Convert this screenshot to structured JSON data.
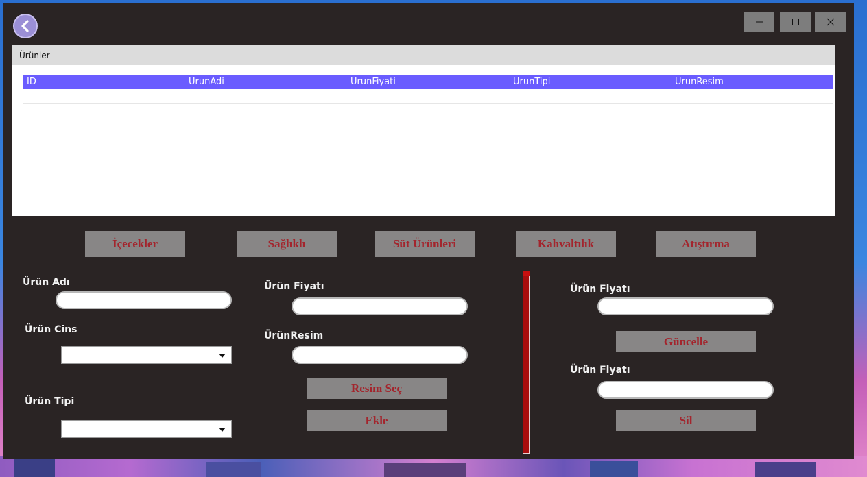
{
  "grid": {
    "caption": "Ürünler",
    "columns": [
      "ID",
      "UrunAdi",
      "UrunFiyati",
      "UrunTipi",
      "UrunResim"
    ]
  },
  "categories": [
    "İçecekler",
    "Sağlıklı",
    "Süt Ürünleri",
    "Kahvaltılık",
    "Atıştırma"
  ],
  "form": {
    "urun_adi_label": "Ürün Adı",
    "urun_cins_label": "Ürün Cins",
    "urun_tipi_label": "Ürün Tipi",
    "urun_fiyati_label": "Ürün Fiyatı",
    "urun_resim_label": "ÜrünResim",
    "resim_sec_label": "Resim Seç",
    "ekle_label": "Ekle",
    "urun_adi_value": "",
    "urun_fiyati_value": "",
    "urun_resim_value": "",
    "urun_cins_selected": "",
    "urun_tipi_selected": ""
  },
  "right_panel": {
    "update_price_label": "Ürün Fiyatı",
    "guncelle_label": "Güncelle",
    "delete_price_label": "Ürün Fiyatı",
    "sil_label": "Sil"
  },
  "colors": {
    "window_bg": "#2a2424",
    "header_accent": "#6a5cff",
    "button_bg": "#888686",
    "button_text": "#a3252d",
    "divider": "#a80e0e"
  },
  "icons": {
    "back": "back-arrow-icon",
    "minimize": "minimize-icon",
    "maximize": "maximize-icon",
    "close": "close-icon"
  }
}
